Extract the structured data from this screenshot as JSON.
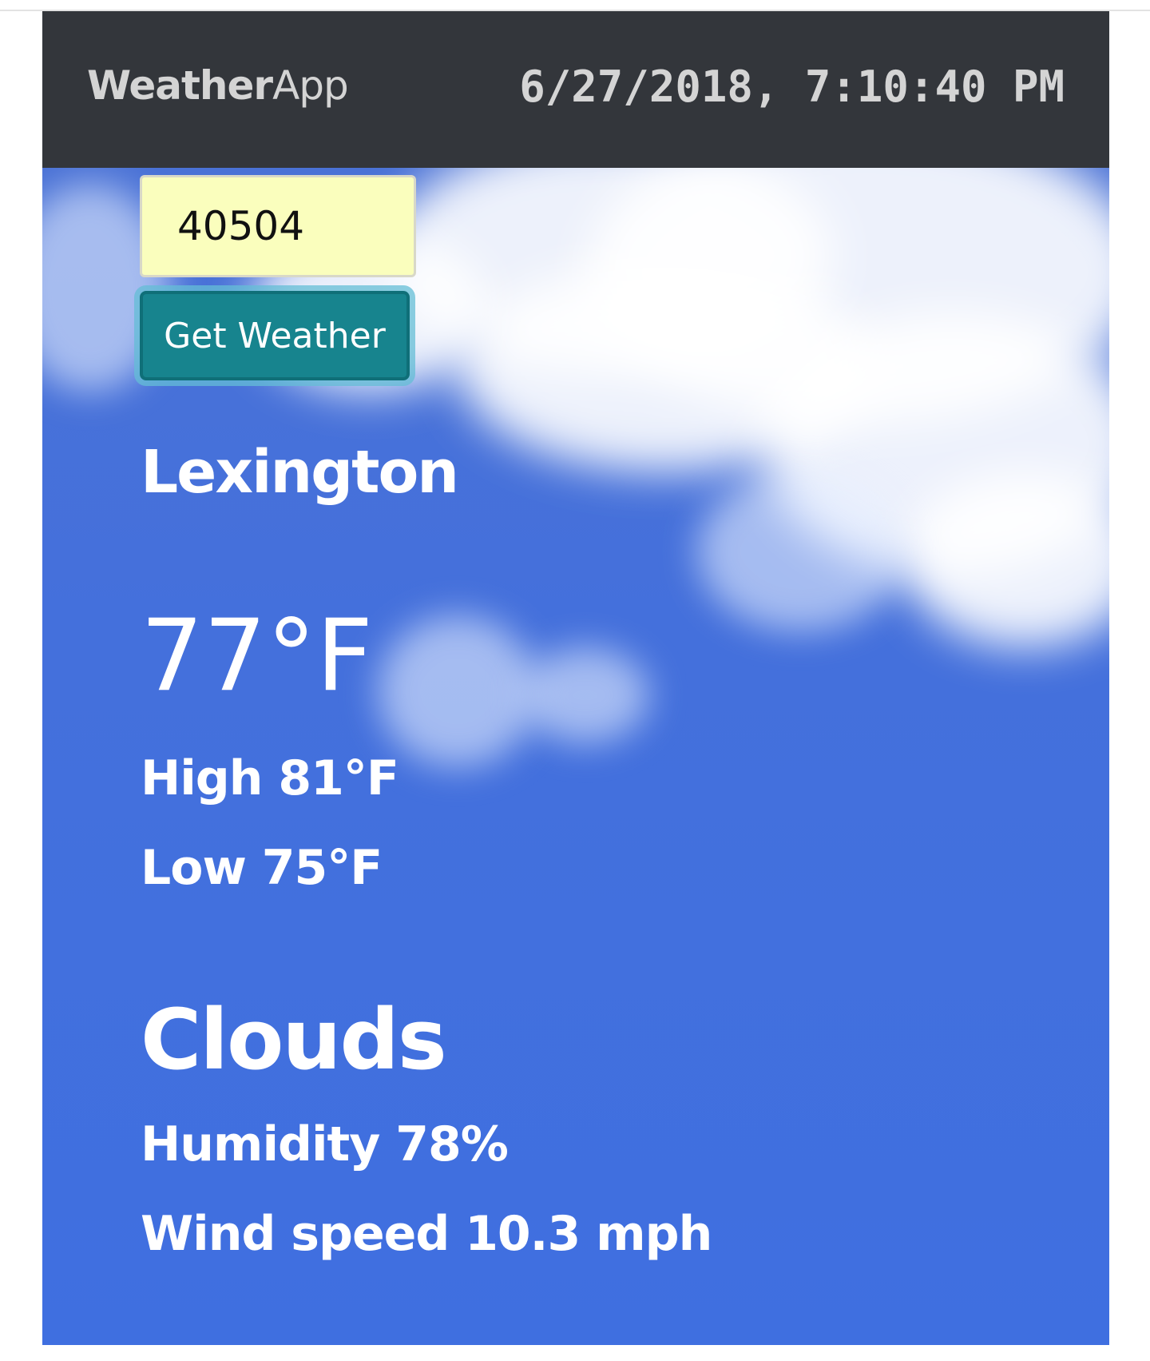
{
  "navbar": {
    "brand_bold": "Weather",
    "brand_light": "App",
    "datetime": "6/27/2018, 7:10:40 PM"
  },
  "search": {
    "zip_value": "40504",
    "button_label": "Get Weather"
  },
  "weather": {
    "city": "Lexington",
    "temperature": "77°F",
    "high": "High 81°F",
    "low": "Low 75°F",
    "condition": "Clouds",
    "humidity": "Humidity 78%",
    "wind": "Wind speed 10.3 mph"
  },
  "colors": {
    "navbar_bg": "#33363b",
    "sky_blue": "#4470dc",
    "input_bg": "#fafebd",
    "button_bg": "#17848e"
  }
}
